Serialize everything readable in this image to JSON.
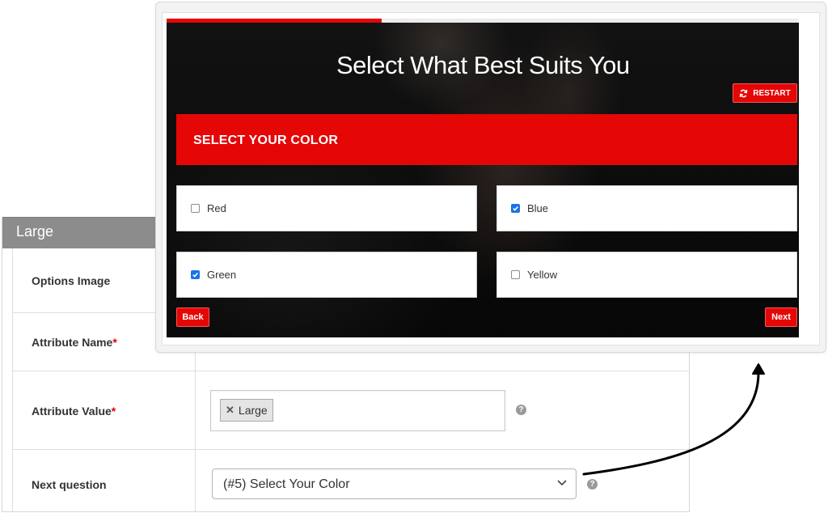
{
  "admin": {
    "header_title": "Large",
    "rows": [
      {
        "label": "Options Image",
        "required": false
      },
      {
        "label": "Attribute Name",
        "required": true
      },
      {
        "label": "Attribute Value",
        "required": true
      },
      {
        "label": "Next question",
        "required": false
      }
    ],
    "required_mark": "*",
    "attribute_value_tags": [
      "Large"
    ],
    "tag_remove_glyph": "✕",
    "next_question_selected": "(#5) Select Your Color",
    "help_glyph": "?"
  },
  "quiz": {
    "title": "Select What Best Suits You",
    "progress_fraction": 0.34,
    "restart_label": "RESTART",
    "section_title": "SELECT YOUR COLOR",
    "options": [
      {
        "label": "Red",
        "checked": false
      },
      {
        "label": "Blue",
        "checked": true
      },
      {
        "label": "Green",
        "checked": true
      },
      {
        "label": "Yellow",
        "checked": false
      }
    ],
    "back_label": "Back",
    "next_label": "Next"
  },
  "colors": {
    "accent_red": "#e50606",
    "checkbox_blue": "#1a73e8",
    "admin_header_gray": "#8c8c8c"
  }
}
